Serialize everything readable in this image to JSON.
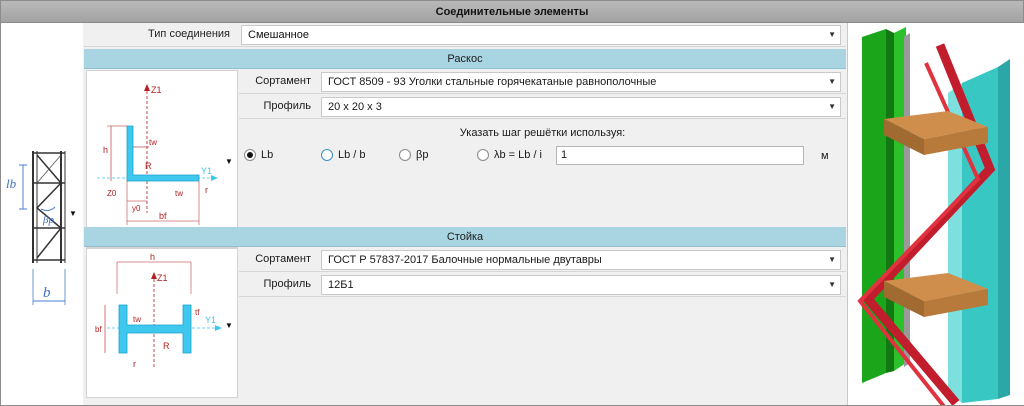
{
  "window": {
    "title": "Соединительные элементы"
  },
  "connection": {
    "label": "Тип соединения",
    "value": "Смешанное"
  },
  "brace": {
    "header": "Раскос",
    "assortment_label": "Сортамент",
    "assortment_value": "ГОСТ 8509 - 93 Уголки стальные горячекатаные равнополочные",
    "profile_label": "Профиль",
    "profile_value": "20 x 20 x 3",
    "grid_caption": "Указать шаг решётки используя:",
    "options": [
      "Lb",
      "Lb / b",
      "βр",
      "λb = Lb / i"
    ],
    "selected_option": "Lb",
    "step_value": "1",
    "unit": "м",
    "diagram_labels": {
      "z1": "Z1",
      "y1": "Y1",
      "h": "h",
      "tw": "tw",
      "r_big": "R",
      "tw2": "tw",
      "r_small": "r",
      "z0": "Z0",
      "y0": "y0",
      "bf": "bf"
    }
  },
  "column": {
    "header": "Стойка",
    "assortment_label": "Сортамент",
    "assortment_value": "ГОСТ Р 57837-2017 Балочные нормальные двутавры",
    "profile_label": "Профиль",
    "profile_value": "12Б1",
    "diagram_labels": {
      "h": "h",
      "z1": "Z1",
      "y1": "Y1",
      "tw": "tw",
      "tf": "tf",
      "bf": "bf",
      "r_big": "R",
      "r_small": "r"
    }
  },
  "lattice_diagram": {
    "lb": "lb",
    "beta": "βр",
    "b": "b"
  },
  "colors": {
    "header_bg": "#a9d5e2",
    "profile_cyan": "#3ec8ee",
    "dim_red": "#b52020",
    "column_green": "#22b422",
    "column_teal": "#3cc6c6",
    "brace_red": "#d42a3a",
    "plate_brown": "#b97a3c"
  }
}
